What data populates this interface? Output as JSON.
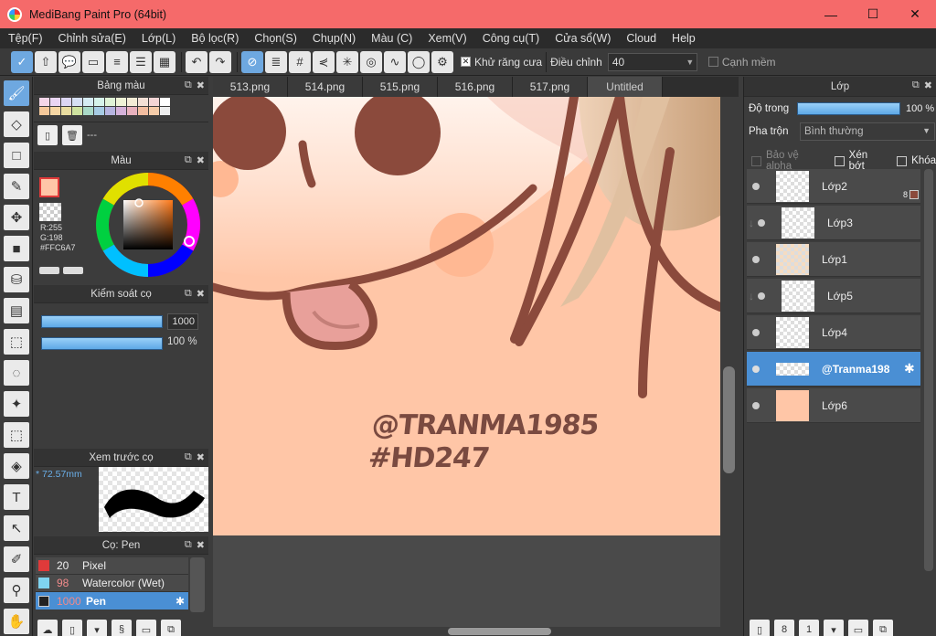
{
  "window": {
    "title": "MediBang Paint Pro (64bit)",
    "minimize": "—",
    "maximize": "☐",
    "close": "✕"
  },
  "menu": [
    "Tệp(F)",
    "Chỉnh sửa(E)",
    "Lớp(L)",
    "Bộ lọc(R)",
    "Chọn(S)",
    "Chụp(N)",
    "Màu (C)",
    "Xem(V)",
    "Công cụ(T)",
    "Cửa sổ(W)",
    "Cloud",
    "Help"
  ],
  "toolbar": {
    "antialias_label": "Khử răng cưa",
    "correction_label": "Điều chỉnh",
    "correction_value": "40",
    "soft_edge_label": "Cạnh mềm"
  },
  "palette_panel": {
    "title": "Bảng màu",
    "info": "---"
  },
  "color_panel": {
    "title": "Màu",
    "r": "R:255",
    "g": "G:198",
    "hex": "#FFC6A7",
    "primary_color": "#ffc6a7"
  },
  "brush_control": {
    "title": "Kiểm soát cọ",
    "size_value": "1000",
    "opacity_value": "100 %"
  },
  "brush_preview": {
    "title": "Xem trước cọ",
    "size": "* 72.57mm"
  },
  "brush_list": {
    "title": "Cọ: Pen",
    "items": [
      {
        "size": "20",
        "name": "Pixel",
        "color": "#e03a3a"
      },
      {
        "size": "98",
        "name": "Watercolor (Wet)",
        "color": "#7fd4f0"
      },
      {
        "size": "1000",
        "name": "Pen",
        "color": "#222222"
      }
    ]
  },
  "tabs": [
    "513.png",
    "514.png",
    "515.png",
    "516.png",
    "517.png",
    "Untitled"
  ],
  "canvas": {
    "watermark_line1": "@TRANMA1985",
    "watermark_line2": "#HD247"
  },
  "layer_panel": {
    "title": "Lớp",
    "opacity_label": "Độ trong",
    "opacity_value": "100 %",
    "blend_label": "Pha trộn",
    "blend_value": "Bình thường",
    "protect_alpha": "Bảo vệ alpha",
    "clipping": "Xén bớt",
    "lock": "Khóa",
    "layers": [
      {
        "name": "Lớp2",
        "badge": "8"
      },
      {
        "name": "Lớp3"
      },
      {
        "name": "Lớp1"
      },
      {
        "name": "Lớp5"
      },
      {
        "name": "Lớp4"
      },
      {
        "name": "@Tranma198"
      },
      {
        "name": "Lớp6"
      }
    ]
  },
  "colors": {
    "accent": "#4a8fd4",
    "titlebar": "#f56a6a",
    "skin": "#ffc6a7",
    "outline": "#8b4a3c"
  }
}
